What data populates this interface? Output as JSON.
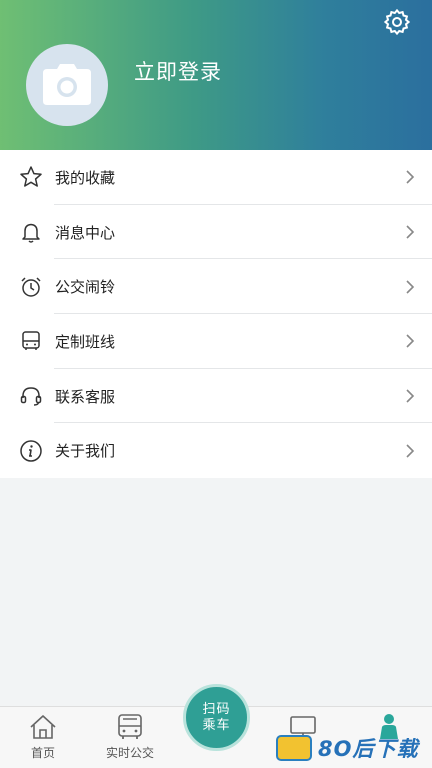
{
  "header": {
    "login_text": "立即登录"
  },
  "menu": {
    "items": [
      {
        "label": "我的收藏",
        "icon": "star-icon"
      },
      {
        "label": "消息中心",
        "icon": "bell-icon"
      },
      {
        "label": "公交闹铃",
        "icon": "alarm-clock-icon"
      },
      {
        "label": "定制班线",
        "icon": "bus-icon"
      },
      {
        "label": "联系客服",
        "icon": "headset-icon"
      },
      {
        "label": "关于我们",
        "icon": "info-icon"
      }
    ]
  },
  "scan": {
    "line1": "扫码",
    "line2": "乘车"
  },
  "tabbar": {
    "tabs": [
      {
        "label": "首页",
        "icon": "home-icon"
      },
      {
        "label": "实时公交",
        "icon": "bus-front-icon"
      },
      {
        "label": "",
        "icon": "monitor-icon"
      },
      {
        "label": "",
        "icon": "person-icon",
        "active": true
      }
    ]
  },
  "watermark": {
    "text": "8O后下载"
  },
  "colors": {
    "header_gradient_start": "#6fbf73",
    "header_gradient_end": "#2b6f9e",
    "accent": "#2f9f95",
    "active_tab": "#2aa79b"
  }
}
